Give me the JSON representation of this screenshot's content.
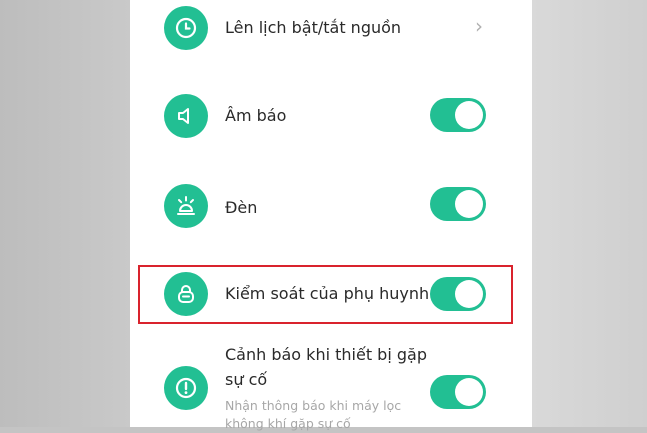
{
  "settings": {
    "items": [
      {
        "label": "Lên lịch bật/tắt nguồn",
        "icon": "clock-icon",
        "control": "chevron"
      },
      {
        "label": "Âm báo",
        "icon": "speaker-icon",
        "control": "toggle",
        "on": true
      },
      {
        "label": "Đèn",
        "icon": "light-icon",
        "control": "toggle",
        "on": true
      },
      {
        "label": "Kiểm soát của phụ huynh",
        "icon": "lock-icon",
        "control": "toggle",
        "on": true,
        "highlighted": true
      },
      {
        "label_line1": "Cảnh báo khi thiết bị gặp",
        "label_line2": "sự cố",
        "desc_line1": "Nhận thông báo khi máy lọc",
        "desc_line2": "không khí gặp sự cố",
        "icon": "alert-icon",
        "control": "toggle",
        "on": true
      }
    ],
    "chevron_glyph": "›"
  },
  "colors": {
    "accent": "#22bf93",
    "highlight_border": "#d9232d",
    "text": "#2a2a2a",
    "subtext": "#a7a7a7"
  }
}
